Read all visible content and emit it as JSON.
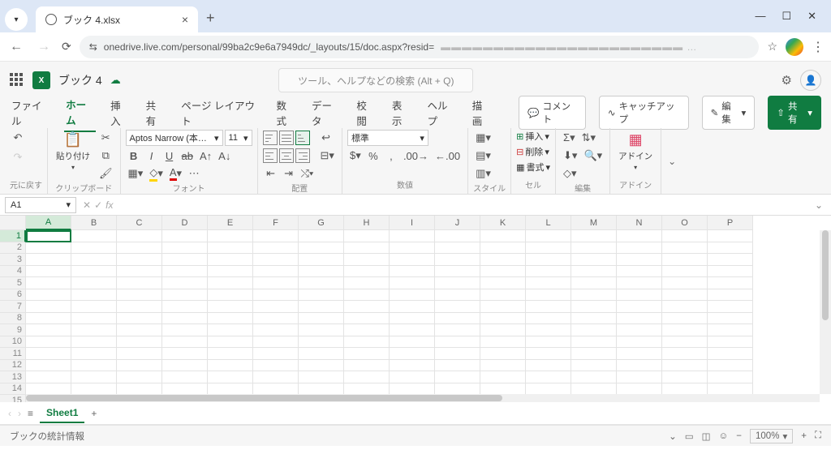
{
  "browser": {
    "tab_title": "ブック 4.xlsx",
    "url": "onedrive.live.com/personal/99ba2c9e6a7949dc/_layouts/15/doc.aspx?resid="
  },
  "header": {
    "doc_name": "ブック 4",
    "search_placeholder": "ツール、ヘルプなどの検索 (Alt + Q)"
  },
  "menu": {
    "file": "ファイル",
    "home": "ホーム",
    "insert": "挿入",
    "share": "共有",
    "layout": "ページ レイアウト",
    "formulas": "数式",
    "data": "データ",
    "review": "校閲",
    "view": "表示",
    "help": "ヘルプ",
    "draw": "描画",
    "comments": "コメント",
    "catchup": "キャッチアップ",
    "editing": "編集",
    "share_btn": "共有"
  },
  "ribbon": {
    "undo_label": "元に戻す",
    "paste": "貼り付け",
    "clipboard": "クリップボード",
    "font_name": "Aptos Narrow (本…",
    "font_size": "11",
    "font": "フォント",
    "alignment": "配置",
    "number_format": "標準",
    "number": "数値",
    "styles": "スタイル",
    "cells_insert": "挿入",
    "cells_delete": "削除",
    "cells_format": "書式",
    "cells": "セル",
    "editing": "編集",
    "addins_label": "アドイン",
    "addins": "アドイン"
  },
  "formula": {
    "name_box": "A1"
  },
  "grid": {
    "columns": [
      "A",
      "B",
      "C",
      "D",
      "E",
      "F",
      "G",
      "H",
      "I",
      "J",
      "K",
      "L",
      "M",
      "N",
      "O",
      "P"
    ],
    "rows": [
      "1",
      "2",
      "3",
      "4",
      "5",
      "6",
      "7",
      "8",
      "9",
      "10",
      "11",
      "12",
      "13",
      "14",
      "15"
    ],
    "selected": "A1"
  },
  "sheets": {
    "active": "Sheet1"
  },
  "status": {
    "text": "ブックの統計情報",
    "zoom": "100%"
  }
}
